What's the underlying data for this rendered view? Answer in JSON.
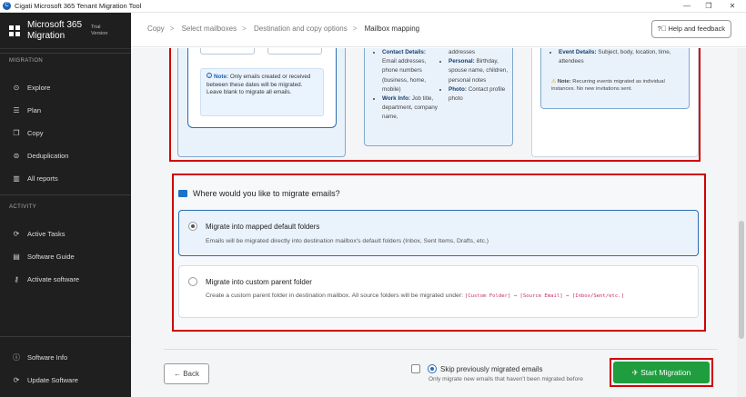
{
  "window": {
    "title": "Cigati Microsoft 365 Tenant Migration Tool",
    "minimize": "—",
    "restore": "❐",
    "close": "✕"
  },
  "brand": {
    "name_line1": "Microsoft 365",
    "name_line2": "Migration",
    "badge_line1": "Trial",
    "badge_line2": "Version"
  },
  "sidebar": {
    "migration_label": "MIGRATION",
    "migration_items": [
      {
        "label": "Explore",
        "icon": "compass-icon",
        "glyph": "⊙"
      },
      {
        "label": "Plan",
        "icon": "list-icon",
        "glyph": "☰"
      },
      {
        "label": "Copy",
        "icon": "copy-icon",
        "glyph": "❐"
      },
      {
        "label": "Deduplication",
        "icon": "dedup-icon",
        "glyph": "⊜"
      },
      {
        "label": "All reports",
        "icon": "bar-chart-icon",
        "glyph": "▥"
      }
    ],
    "activity_label": "ACTIVITY",
    "activity_items": [
      {
        "label": "Active Tasks",
        "icon": "refresh-icon",
        "glyph": "⟳"
      },
      {
        "label": "Software Guide",
        "icon": "book-icon",
        "glyph": "▤"
      },
      {
        "label": "Activate software",
        "icon": "key-icon",
        "glyph": "⚷"
      }
    ],
    "bottom_items": [
      {
        "label": "Software Info",
        "icon": "info-icon",
        "glyph": "ⓘ"
      },
      {
        "label": "Update Software",
        "icon": "update-icon",
        "glyph": "⟳"
      }
    ]
  },
  "breadcrumb": {
    "items": [
      "Copy",
      "Select mailboxes",
      "Destination and copy options",
      "Mailbox mapping"
    ],
    "separator": ">"
  },
  "help_button": {
    "icon": "question-icon",
    "label": "Help and feedback"
  },
  "email_filter_note": {
    "label": "Note:",
    "text": "Only emails created or received between these dates will be migrated. Leave blank to migrate all emails."
  },
  "contacts_card": {
    "left": [
      {
        "head": "Contact Details:",
        "text": "Email addresses, phone numbers (business, home, mobile)"
      },
      {
        "head": "Work Info:",
        "text": "Job title, department, company name,"
      }
    ],
    "right_prefix": "addresses",
    "right": [
      {
        "head": "Personal:",
        "text": "Birthday, spouse name, children, personal notes"
      },
      {
        "head": "Photo:",
        "text": "Contact profile photo"
      }
    ]
  },
  "calendar_card": {
    "event": {
      "head": "Event Details:",
      "text": "Subject, body, location, time, attendees"
    },
    "note_label": "Note:",
    "note_text": "Recurring events migrated as individual instances. No new invitations sent."
  },
  "destination": {
    "question": "Where would you like to migrate emails?",
    "options": [
      {
        "title": "Migrate into mapped default folders",
        "desc": "Emails will be migrated directly into destination mailbox's default folders (Inbox, Sent Items, Drafts, etc.)",
        "selected": true
      },
      {
        "title": "Migrate into custom parent folder",
        "desc": "Create a custom parent folder in destination mailbox. All source folders will be migrated under:",
        "code": "[Custom Folder] → [Source Email] → [Inbox/Sent/etc.]",
        "selected": false
      }
    ]
  },
  "footer": {
    "back_label": "Back",
    "skip_label": "Skip previously migrated emails",
    "skip_desc": "Only migrate new emails that haven't been migrated before",
    "start_label": "Start Migration"
  },
  "colors": {
    "accent": "#2b6cb0",
    "start": "#1f9d3f",
    "highlight": "#d10000",
    "sidebar": "#1f1f1f"
  }
}
